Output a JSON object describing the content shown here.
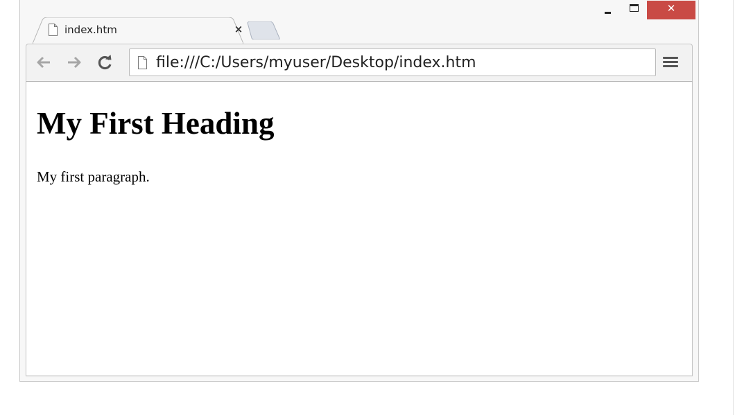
{
  "window": {
    "tab_title": "index.htm",
    "close_glyph": "×",
    "controls": [
      "minimize",
      "maximize",
      "close"
    ]
  },
  "toolbar": {
    "url": "file:///C:/Users/myuser/Desktop/index.htm"
  },
  "page": {
    "heading": "My First Heading",
    "paragraph": "My first paragraph."
  },
  "colors": {
    "close_button": "#c94a45",
    "chrome_background": "#f2f2f2",
    "content_background": "#ffffff"
  },
  "icons": {
    "tab_icon": "document-icon",
    "back": "back-arrow-icon",
    "forward": "forward-arrow-icon",
    "reload": "reload-icon",
    "omnibox_icon": "document-icon",
    "menu": "hamburger-menu-icon"
  }
}
